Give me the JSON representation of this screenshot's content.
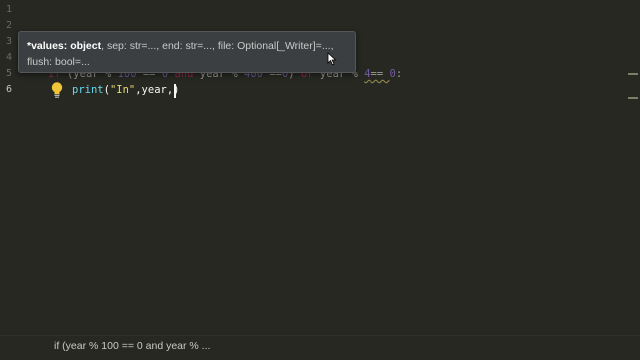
{
  "editor": {
    "line_numbers": [
      "1",
      "2",
      "3",
      "4",
      "5",
      "6"
    ],
    "active_line": "6",
    "line5": {
      "kw_if": "if",
      "p1": " (year % ",
      "n100": "100",
      "p2": " == ",
      "n0a": "0",
      "kw_and": "and",
      "p3": " year % ",
      "n400": "400",
      "p4": " ==",
      "n0b": "0",
      "p5": ") ",
      "kw_or": "or",
      "p6": " year % ",
      "n4": "4",
      "p7": "== ",
      "n0c": "0",
      "p8": ":"
    },
    "line6": {
      "fn_print": "print",
      "p1": "(",
      "s_in": "\"In\"",
      "p2": ",year,)"
    }
  },
  "tooltip": {
    "current_param": "*values: object",
    "rest_line1": ", sep: str=..., end: str=..., file: Optional[_Writer]=...,",
    "line2": "flush: bool=..."
  },
  "statusbar": {
    "context": "if (year % 100 == 0 and year % ..."
  },
  "colors": {
    "background": "#272822",
    "keyword": "#f92672",
    "number": "#ae81ff",
    "string": "#e6db74",
    "function": "#66d9ef"
  }
}
